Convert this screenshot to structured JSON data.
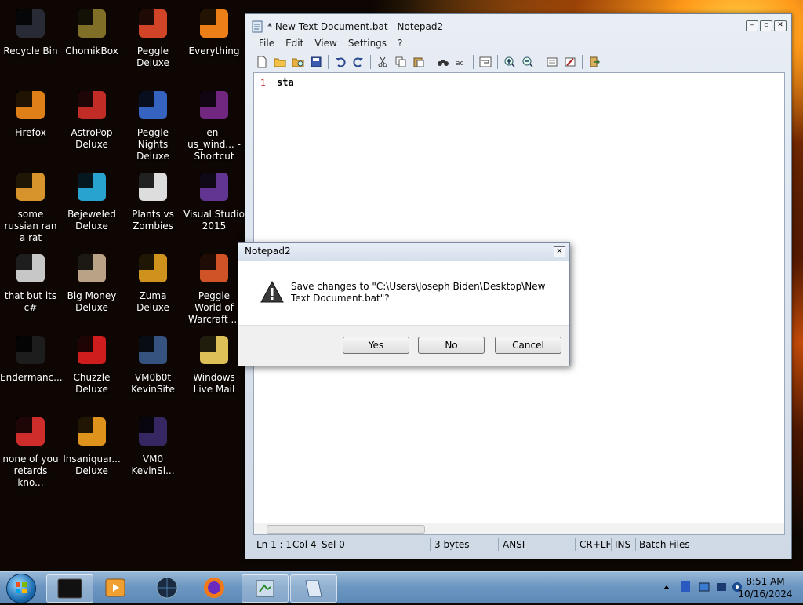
{
  "desktop": {
    "icons": [
      {
        "label": "Recycle Bin",
        "icon": "recycle-bin-icon",
        "color": "#2a2f3a"
      },
      {
        "label": "ChomikBox",
        "icon": "chomikbox-icon",
        "color": "#8a7a2a"
      },
      {
        "label": "Peggle Deluxe",
        "icon": "peggle-icon",
        "color": "#e24a2a"
      },
      {
        "label": "Everything",
        "icon": "everything-icon",
        "color": "#ff8a1a"
      },
      {
        "label": "Firefox",
        "icon": "firefox-icon",
        "color": "#f08a1a"
      },
      {
        "label": "AstroPop Deluxe",
        "icon": "astropop-icon",
        "color": "#d0302a"
      },
      {
        "label": "Peggle Nights Deluxe",
        "icon": "peggle-nights-icon",
        "color": "#3a6ad0"
      },
      {
        "label": "en-us_wind... - Shortcut",
        "icon": "winrar-icon",
        "color": "#7a2a8a"
      },
      {
        "label": "some russian ran a rat",
        "icon": "shortcut-icon",
        "color": "#e8a030"
      },
      {
        "label": "Bejeweled Deluxe",
        "icon": "bejeweled-icon",
        "color": "#2ab0e0"
      },
      {
        "label": "Plants vs Zombies",
        "icon": "pvz-icon",
        "color": "#f0f0f0"
      },
      {
        "label": "Visual Studio 2015",
        "icon": "visual-studio-icon",
        "color": "#6a3aa0"
      },
      {
        "label": "that but its c#",
        "icon": "copy-icon",
        "color": "#d8d8d8"
      },
      {
        "label": "Big Money Deluxe",
        "icon": "big-money-icon",
        "color": "#c8b090"
      },
      {
        "label": "Zuma Deluxe",
        "icon": "zuma-icon",
        "color": "#e0a020"
      },
      {
        "label": "Peggle World of Warcraft ...",
        "icon": "peggle-wow-icon",
        "color": "#e05a2a"
      },
      {
        "label": "Endermanc...",
        "icon": "terminal-icon",
        "color": "#202020"
      },
      {
        "label": "Chuzzle Deluxe",
        "icon": "chuzzle-icon",
        "color": "#e02020"
      },
      {
        "label": "VM0b0t KevinSite",
        "icon": "vm-icon",
        "color": "#3a5a8a"
      },
      {
        "label": "Windows Live Mail",
        "icon": "live-mail-icon",
        "color": "#f0d060"
      },
      {
        "label": "none of you retards kno...",
        "icon": "chrome-like-icon",
        "color": "#e03030"
      },
      {
        "label": "Insaniquar... Deluxe",
        "icon": "insaniquarium-icon",
        "color": "#f0a020"
      },
      {
        "label": "VM0 KevinSi...",
        "icon": "file-icon",
        "color": "#3a2a6a"
      }
    ]
  },
  "notepad": {
    "title": "* New Text Document.bat - Notepad2",
    "menu": [
      "File",
      "Edit",
      "View",
      "Settings",
      "?"
    ],
    "toolbar": [
      "new-icon",
      "open-icon",
      "browse-icon",
      "save-icon",
      "undo-icon",
      "redo-icon",
      "cut-icon",
      "copy-icon",
      "paste-icon",
      "find-icon",
      "replace-icon",
      "wordwrap-icon",
      "zoom-in-icon",
      "zoom-out-icon",
      "scheme-icon",
      "customize-icon",
      "exit-icon"
    ],
    "line_number": "1",
    "content": "sta",
    "status": {
      "position": "Ln 1 : 1",
      "col": "Col 4",
      "sel": "Sel 0",
      "size": "3 bytes",
      "encoding": "ANSI",
      "eol": "CR+LF",
      "mode": "INS",
      "scheme": "Batch Files"
    }
  },
  "dialog": {
    "title": "Notepad2",
    "message": "Save changes to \"C:\\Users\\Joseph Biden\\Desktop\\New Text Document.bat\"?",
    "buttons": {
      "yes": "Yes",
      "no": "No",
      "cancel": "Cancel"
    }
  },
  "taskbar": {
    "time": "8:51 AM",
    "date": "10/16/2024"
  },
  "colors": {
    "accent": "#5c88b7",
    "line_number": "#c02020"
  }
}
